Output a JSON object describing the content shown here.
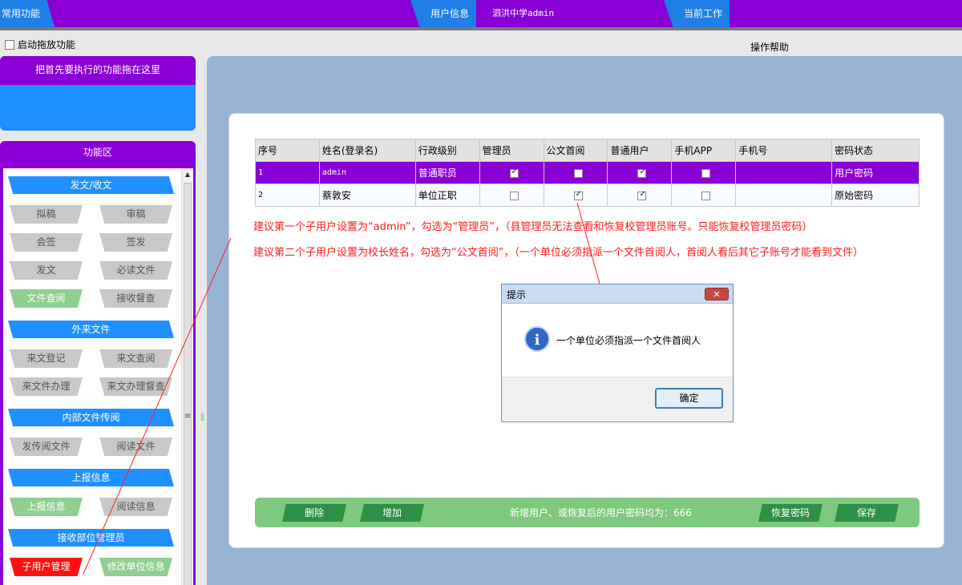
{
  "topbar": {
    "common_label": "常用功能",
    "user_info_label": "用户信息",
    "school": "泗洪中学admin",
    "current_work_label": "当前工作",
    "bg_color": "#8a00d4",
    "accent_color": "#1f7fe6"
  },
  "drag_toggle_label": "启动拖放功能",
  "help_label": "操作帮助",
  "quick_panel_title": "把首先要执行的功能拖在这里",
  "func_panel": {
    "title": "功能区",
    "sections": [
      {
        "label": "发文/收文",
        "buttons": [
          "拟稿",
          "审稿",
          "会签",
          "签发",
          "发文",
          "必读文件",
          "文件查阅",
          "接收督查"
        ]
      },
      {
        "label": "外来文件",
        "buttons": [
          "来文登记",
          "来文查阅",
          "来文件办理",
          "来文办理督查"
        ]
      },
      {
        "label": "内部文件传阅",
        "buttons": [
          "发传阅文件",
          "阅读文件"
        ]
      },
      {
        "label": "上报信息",
        "buttons": [
          "上报信息",
          "阅读信息"
        ]
      },
      {
        "label": "接收部位管理员",
        "buttons": [
          "子用户管理",
          "修改单位信息"
        ]
      }
    ]
  },
  "table": {
    "headers": [
      "序号",
      "姓名(登录名)",
      "行政级别",
      "管理员",
      "公文首阅",
      "普通用户",
      "手机APP",
      "手机号",
      "密码状态"
    ],
    "rows": [
      {
        "no": "1",
        "name": "admin",
        "level": "普通职员",
        "admin": true,
        "first_read": false,
        "normal_user": true,
        "app": false,
        "phone": "",
        "pwd_status": "用户密码"
      },
      {
        "no": "2",
        "name": "蔡敦安",
        "level": "单位正职",
        "admin": false,
        "first_read": true,
        "normal_user": true,
        "app": false,
        "phone": "",
        "pwd_status": "原始密码"
      }
    ]
  },
  "notes": [
    "建议第一个子用户设置为“admin”，勾选为“管理员”，（县管理员无法查看和恢复校管理员账号。只能恢复校管理员密码）",
    "建议第二个子用户设置为校长姓名，勾选为“公文首阅”，（一个单位必须指派一个文件首阅人，首阅人看后其它子账号才能看到文件）"
  ],
  "dialog": {
    "title": "提示",
    "message": "一个单位必须指派一个文件首阅人",
    "ok_label": "确定",
    "close_glyph": "✕",
    "icon": "info-icon"
  },
  "bottom": {
    "delete_label": "删除",
    "add_label": "增加",
    "info": "新增用户、或恢复后的用户密码均为：666",
    "restore_label": "恢复密码",
    "save_label": "保存"
  }
}
